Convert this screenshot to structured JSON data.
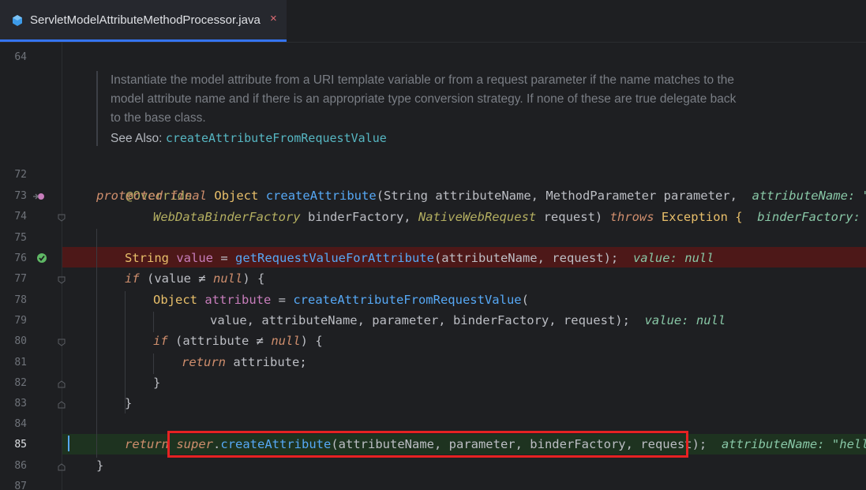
{
  "tab": {
    "filename": "ServletModelAttributeMethodProcessor.java",
    "close_glyph": "×",
    "icon": "java-class-icon"
  },
  "colors": {
    "accent": "#3574f0",
    "error_line": "#4d1818",
    "success_line": "#1e3320",
    "annotation_box": "#e52222"
  },
  "line_numbers": [
    "64",
    "72",
    "73",
    "74",
    "75",
    "76",
    "77",
    "78",
    "79",
    "80",
    "81",
    "82",
    "83",
    "84",
    "85",
    "86",
    "87"
  ],
  "doc": {
    "text": "Instantiate the model attribute from a URI template variable or from a request parameter if the name matches to the model attribute name and if there is an appropriate type conversion strategy. If none of these are true delegate back to the base class.",
    "see_also_label": "See Also:",
    "see_also_link": "createAttributeFromRequestValue"
  },
  "code": {
    "l72": "@Override",
    "l73_protected": "protected",
    "l73_final": "final",
    "l73_type": "Object",
    "l73_fn": "createAttribute",
    "l73_rest": "(String attributeName, MethodParameter parameter,",
    "l73_hint": "attributeName: \"hello\"",
    "l74_t1": "WebDataBinderFactory",
    "l74_p1": " binderFactory, ",
    "l74_t2": "NativeWebRequest",
    "l74_p2": " request) ",
    "l74_throws": "throws",
    "l74_exc": " Exception {",
    "l74_hint": "binderFactory: ServletRequestDataBinderFactory",
    "l76_type": "String",
    "l76_var": " value",
    "l76_eq": " = ",
    "l76_fn": "getRequestValueForAttribute",
    "l76_args": "(attributeName, request);",
    "l76_hint": "value: null",
    "l77_if": "if",
    "l77_cond": " (value ≠ ",
    "l77_null": "null",
    "l77_end": ") {",
    "l78_type": "Object",
    "l78_var": " attribute",
    "l78_eq": " = ",
    "l78_fn": "createAttributeFromRequestValue",
    "l78_paren": "(",
    "l79_args": "value, attributeName, parameter, binderFactory, request);",
    "l79_hint": "value: null",
    "l80_if": "if",
    "l80_cond": " (attribute ≠ ",
    "l80_null": "null",
    "l80_end": ") {",
    "l81_return": "return",
    "l81_val": " attribute;",
    "l82": "}",
    "l83": "}",
    "l85_return": "return",
    "l85_super": "super",
    "l85_dot": ".",
    "l85_fn": "createAttribute",
    "l85_args": "(attributeName, parameter, binderFactory, request);",
    "l85_hint": "attributeName: \"hello\"",
    "l86": "}"
  }
}
